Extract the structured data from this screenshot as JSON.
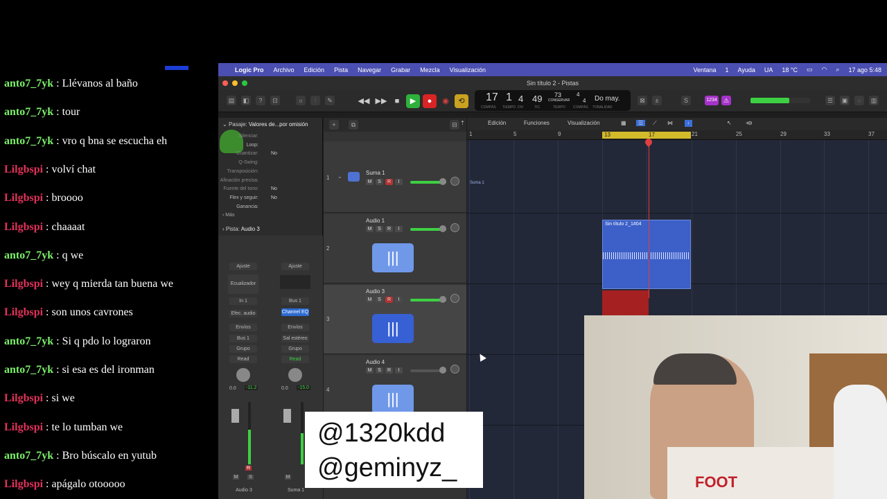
{
  "chat": [
    {
      "user": "anto7_7yk",
      "color": "green",
      "text": "Llévanos al baño"
    },
    {
      "user": "anto7_7yk",
      "color": "green",
      "text": "tour"
    },
    {
      "user": "anto7_7yk",
      "color": "green",
      "text": "vro q bna se escucha eh"
    },
    {
      "user": "Lilgbspi",
      "color": "red",
      "text": "volví chat"
    },
    {
      "user": "Lilgbspi",
      "color": "red",
      "text": "broooo"
    },
    {
      "user": "Lilgbspi",
      "color": "red",
      "text": "chaaaat"
    },
    {
      "user": "anto7_7yk",
      "color": "green",
      "text": "q we"
    },
    {
      "user": "Lilgbspi",
      "color": "red",
      "text": "wey q mierda tan buena we"
    },
    {
      "user": "Lilgbspi",
      "color": "red",
      "text": "son unos cavrones"
    },
    {
      "user": "anto7_7yk",
      "color": "green",
      "text": "Si q pdo lo lograron"
    },
    {
      "user": "anto7_7yk",
      "color": "green",
      "text": "si esa es del ironman"
    },
    {
      "user": "Lilgbspi",
      "color": "red",
      "text": "si we"
    },
    {
      "user": "Lilgbspi",
      "color": "red",
      "text": "te lo tumban we"
    },
    {
      "user": "anto7_7yk",
      "color": "green",
      "text": "Bro búscalo en yutub"
    },
    {
      "user": "Lilgbspi",
      "color": "red",
      "text": "apágalo otooooo"
    }
  ],
  "menubar": {
    "app": "Logic Pro",
    "items": [
      "Archivo",
      "Edición",
      "Pista",
      "Navegar",
      "Grabar",
      "Mezcla",
      "Visualización"
    ],
    "right": [
      "Ventana",
      "1",
      "Ayuda",
      "UA",
      "18 °C",
      "17 ago 5:48"
    ]
  },
  "window_title": "Sin título 2 - Pistas",
  "lcd": {
    "bar": "17",
    "beat": "1",
    "div": "4",
    "tick": "49",
    "tempo": "73",
    "tempo_label": "CONSERVAR",
    "sig_top": "4",
    "sig_bottom": "4",
    "key": "Do may.",
    "labels": [
      "COMPÁS",
      "TIEMPO",
      "DIV",
      "TIC",
      "TEMPO",
      "COMPÁS",
      "TONALIDAD"
    ]
  },
  "toolbar_right": {
    "count_in": "1234"
  },
  "arrange_toolbar": [
    "Edición",
    "Funciones",
    "Visualización"
  ],
  "inspector": {
    "region_header": "Pasaje:",
    "region_name": "Valores de...por omisión",
    "params": [
      {
        "label": "Silenciar:",
        "value": ""
      },
      {
        "label": "Loop:",
        "value": ""
      },
      {
        "label": "Cuantizar:",
        "value": "No"
      },
      {
        "label": "Q-Swing:",
        "value": ""
      },
      {
        "label": "Transposición:",
        "value": ""
      },
      {
        "label": "Afinación precisa:",
        "value": ""
      },
      {
        "label": "Fuente del tono:",
        "value": "No"
      },
      {
        "label": "Flex y seguir:",
        "value": "No"
      },
      {
        "label": "Ganancia:",
        "value": ""
      }
    ],
    "more": "Más",
    "track_header": "Pista:",
    "track_name": "Audio 3",
    "strip1": {
      "ajuste": "Ajuste",
      "eq": "Ecualizador",
      "input": "In 1",
      "fx": "Efec. audio",
      "sends": "Envíos",
      "output": "Bus 1",
      "group": "Grupo",
      "auto": "Read",
      "pan": "0.0",
      "level": "-11.2",
      "name": "Audio 3"
    },
    "strip2": {
      "ajuste": "Ajuste",
      "input": "Bus 1",
      "fx": "Channel EQ",
      "sends": "Envíos",
      "output": "Sal estéreo",
      "group": "Grupo",
      "auto": "Read",
      "pan": "0.0",
      "level": "-15.0",
      "name": "Suma 1"
    }
  },
  "tracks": [
    {
      "num": "1",
      "name": "Suma 1"
    },
    {
      "num": "2",
      "name": "Audio 1"
    },
    {
      "num": "3",
      "name": "Audio 3"
    },
    {
      "num": "4",
      "name": "Audio 4"
    }
  ],
  "ruler": [
    "1",
    "5",
    "9",
    "13",
    "17",
    "21",
    "25",
    "29",
    "33",
    "37"
  ],
  "regions": {
    "summing": "Suma 1",
    "audio1": "Sin título 2_1#04"
  },
  "overlay": {
    "handle1": "@1320kdd",
    "handle2": "@geminyz_"
  },
  "webcam": {
    "shirt": "FOOT"
  },
  "colors": {
    "menubar": "#4b4fb1",
    "region": "#3c5fc8",
    "rec": "#b23333",
    "loop": "#d3ba2a",
    "green_user": "#7cf06a",
    "red_user": "#e2325a"
  }
}
